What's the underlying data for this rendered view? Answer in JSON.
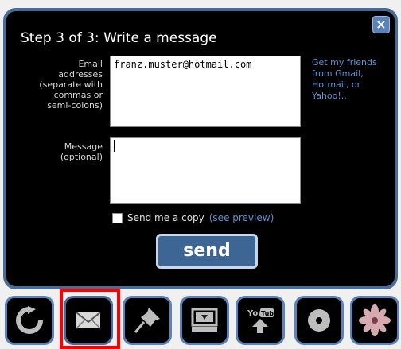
{
  "dialog": {
    "title": "Step 3 of 3: Write a message",
    "close_label": "×",
    "email": {
      "label": "Email\naddresses\n(separate with\ncommas or\nsemi-colons)",
      "value": "franz.muster@hotmail.com"
    },
    "friends_link": "Get my friends from Gmail, Hotmail, or Yahoo!...",
    "message": {
      "label": "Message\n(optional)",
      "value": ""
    },
    "copy": {
      "label": "Send me a copy",
      "preview_link": "(see preview)",
      "checked": false
    },
    "send_label": "send"
  },
  "toolbar": {
    "items": [
      {
        "icon": "refresh-icon"
      },
      {
        "icon": "envelope-icon",
        "selected": true
      },
      {
        "icon": "pushpin-icon"
      },
      {
        "icon": "computer-download-icon"
      },
      {
        "icon": "youtube-upload-icon",
        "text": "You Tube"
      },
      {
        "icon": "disc-icon"
      },
      {
        "icon": "flower-icon"
      }
    ]
  },
  "colors": {
    "panel_border": "#4b6c97",
    "link": "#5c93d4",
    "send_button": "#3e6694",
    "highlight": "#ff0000"
  }
}
